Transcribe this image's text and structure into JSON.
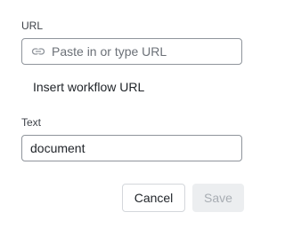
{
  "url_field": {
    "label": "URL",
    "placeholder": "Paste in or type URL",
    "icon": "link-icon"
  },
  "suggestion": {
    "label": "Insert workflow URL"
  },
  "text_field": {
    "label": "Text",
    "value": "document"
  },
  "actions": {
    "cancel_label": "Cancel",
    "save_label": "Save"
  }
}
